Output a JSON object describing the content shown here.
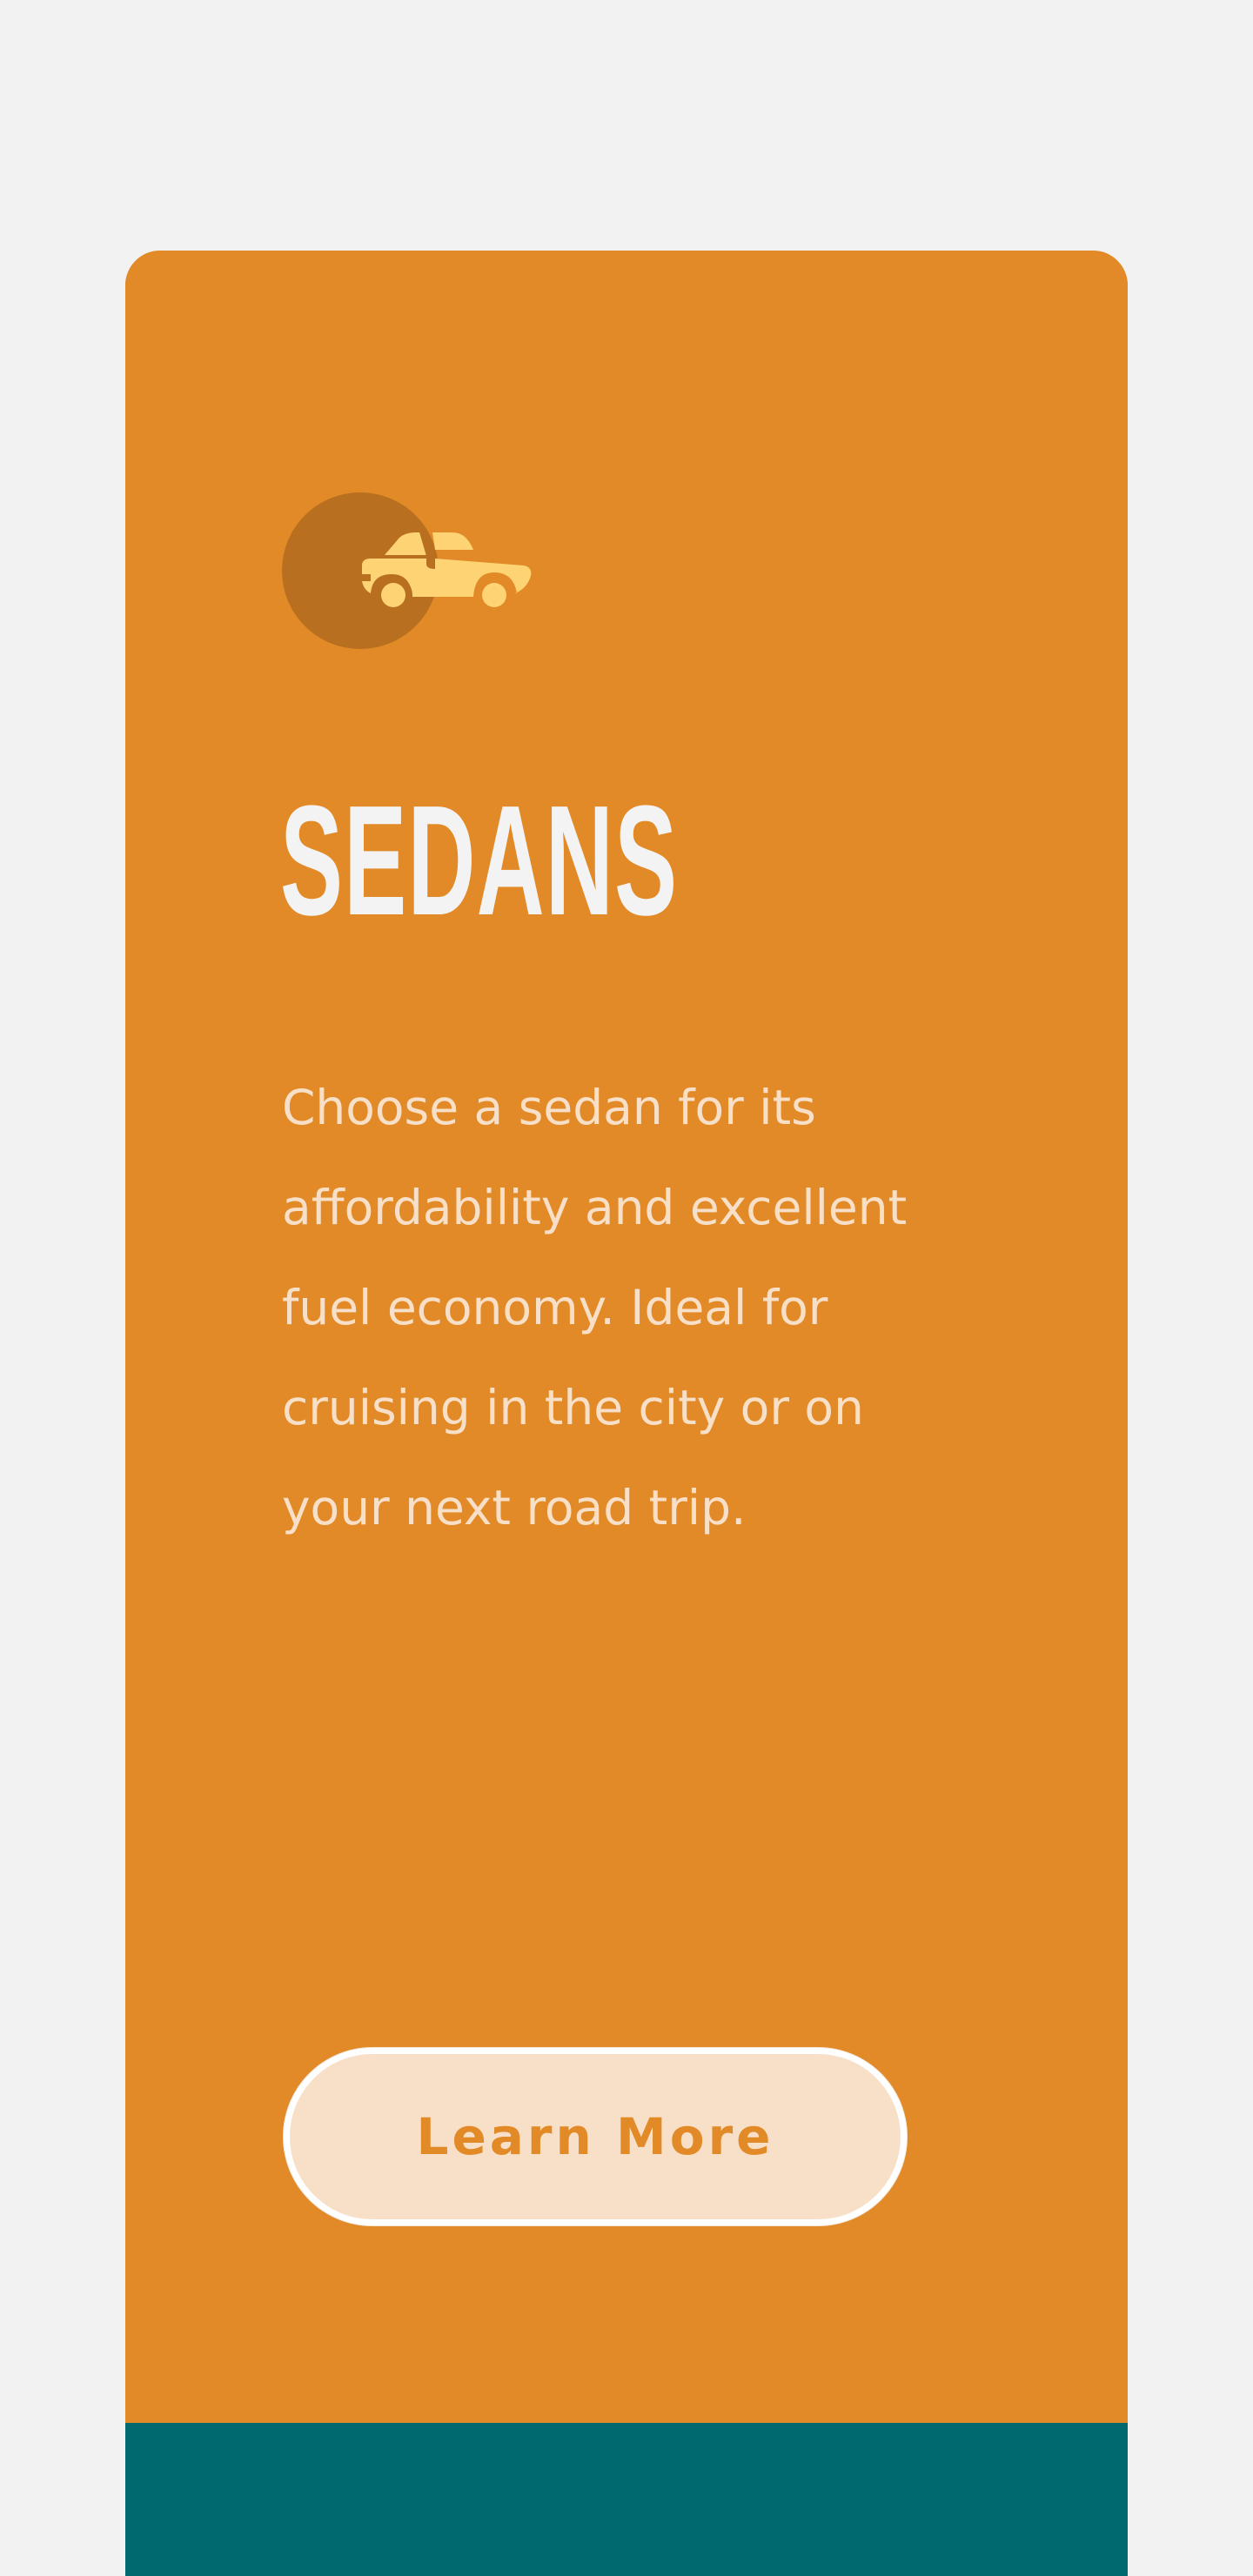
{
  "card": {
    "icon": "car-icon",
    "title": "SEDANS",
    "description": "Choose a sedan for its affordability and excellent fuel economy. Ideal for cruising in the city or on your next road trip.",
    "cta_label": "Learn More"
  },
  "colors": {
    "page_background": "#f2f2f2",
    "card_background": "#e28a28",
    "footer_band": "#006970",
    "icon_circle": "#b96f20",
    "icon_car": "#fdd374",
    "title_text": "#f3f3f3",
    "description_text": "#f8e0c8",
    "button_background": "#f8e0c8",
    "button_text": "#e28a28"
  }
}
